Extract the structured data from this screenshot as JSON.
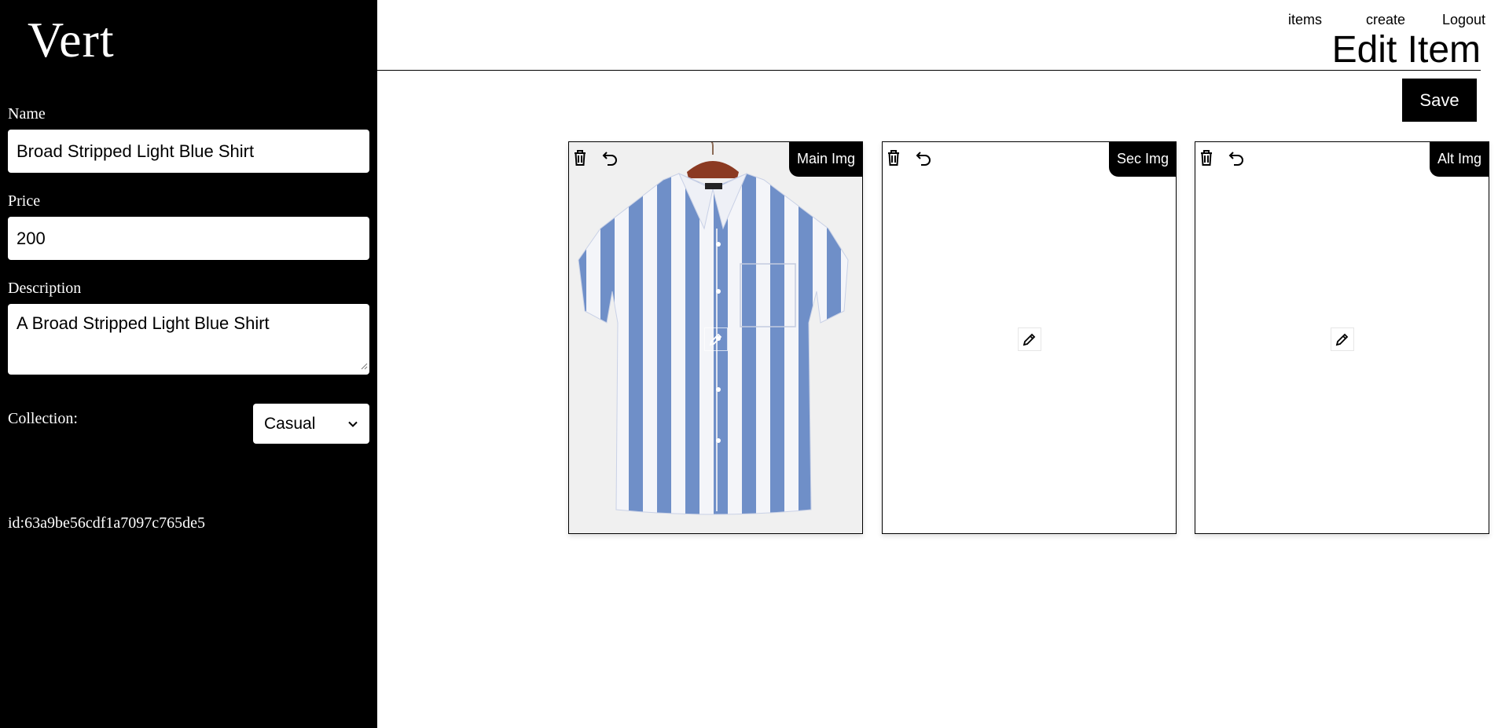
{
  "sidebar": {
    "brand": "Vert",
    "name_label": "Name",
    "name_value": "Broad Stripped Light Blue Shirt",
    "price_label": "Price",
    "price_value": "200",
    "description_label": "Description",
    "description_value": "A Broad Stripped Light Blue Shirt",
    "collection_label": "Collection:",
    "collection_selected": "Casual",
    "item_id": "id:63a9be56cdf1a7097c765de5"
  },
  "nav": {
    "items": "items",
    "create": "create",
    "logout": "Logout"
  },
  "header": {
    "title": "Edit Item",
    "save_label": "Save"
  },
  "images": {
    "main_tag": "Main Img",
    "sec_tag": "Sec Img",
    "alt_tag": "Alt Img"
  },
  "icons": {
    "delete": "trash-icon",
    "undo": "undo-icon",
    "edit": "pencil-icon",
    "dropdown": "chevron-down-icon"
  },
  "colors": {
    "sidebar_bg": "#000000",
    "accent": "#000000",
    "stripe_blue": "#6f8fc8",
    "shirt_white": "#f4f5f9",
    "hanger": "#8b3a22"
  }
}
